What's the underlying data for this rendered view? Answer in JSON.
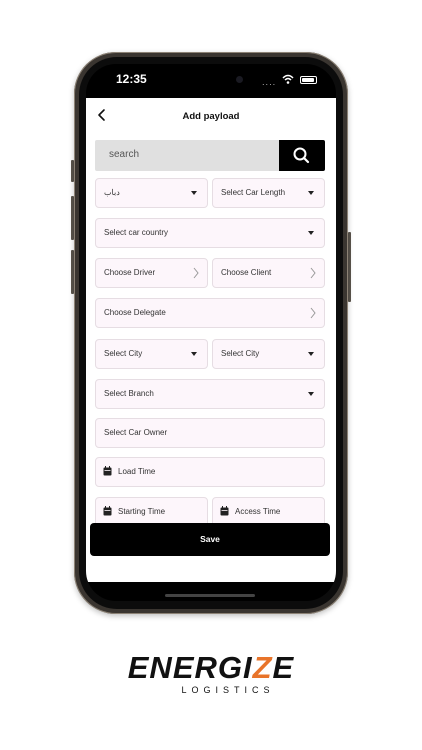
{
  "status_bar": {
    "time": "12:35",
    "signal": "...."
  },
  "header": {
    "title": "Add payload"
  },
  "search": {
    "placeholder": "search"
  },
  "form": {
    "car_type": "دباب",
    "car_length": "Select Car Length",
    "car_country": "Select car country",
    "driver": "Choose Driver",
    "client": "Choose Client",
    "delegate": "Choose Delegate",
    "city_from": "Select City",
    "city_to": "Select City",
    "branch": "Select Branch",
    "car_owner": "Select Car Owner",
    "load_time": "Load Time",
    "starting_time": "Starting Time",
    "access_time": "Access Time"
  },
  "save_button": {
    "label": "Save"
  },
  "brand": {
    "logo_before": "ENERGI",
    "logo_accent": "Z",
    "logo_after": "E",
    "tagline": "LOGISTICS"
  },
  "colors": {
    "field_bg": "#fdf6fb",
    "primary": "#000000",
    "accent": "#e8742a",
    "search_bg": "#e0e0e0"
  }
}
